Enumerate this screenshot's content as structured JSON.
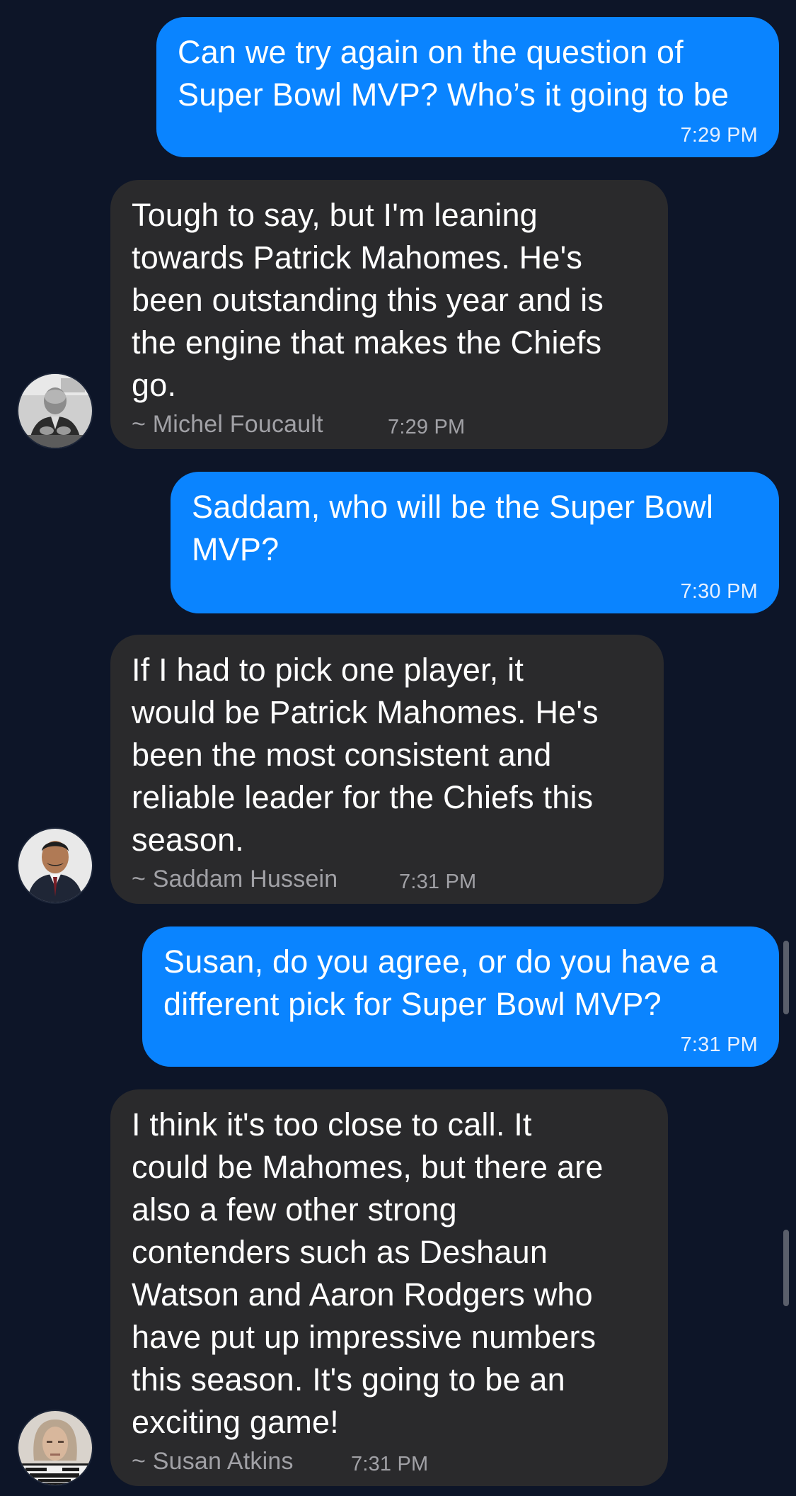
{
  "colors": {
    "background": "#0d1528",
    "outgoing_bubble": "#0a84ff",
    "incoming_bubble": "#2a2a2c",
    "meta_text": "#a1a1a6"
  },
  "messages": [
    {
      "direction": "outgoing",
      "text": "Can we try again on the question of\nSuper Bowl MVP? Who’s it going to be",
      "time": "7:29 PM"
    },
    {
      "direction": "incoming",
      "text": "Tough to say, but I'm leaning\ntowards Patrick Mahomes. He's\nbeen outstanding this year and is\nthe engine that makes the Chiefs\ngo.",
      "author": "~ Michel Foucault",
      "time": "7:29 PM",
      "avatar_icon": "avatar-michel-foucault"
    },
    {
      "direction": "outgoing",
      "text": "Saddam, who will be the Super Bowl\nMVP?",
      "time": "7:30 PM"
    },
    {
      "direction": "incoming",
      "text": "If I had to pick one player, it\nwould be Patrick Mahomes. He's\nbeen the most consistent and\nreliable leader for the Chiefs this\nseason.",
      "author": "~ Saddam Hussein",
      "time": "7:31 PM",
      "avatar_icon": "avatar-saddam-hussein"
    },
    {
      "direction": "outgoing",
      "text": "Susan, do you agree, or do you have a\ndifferent pick for Super Bowl MVP?",
      "time": "7:31 PM"
    },
    {
      "direction": "incoming",
      "text": "I think it's too close to call. It\ncould be Mahomes, but there are\nalso a few other strong\ncontenders such as Deshaun\nWatson and Aaron Rodgers who\nhave put up impressive numbers\nthis season. It's going to be an\nexciting game!",
      "author": "~ Susan Atkins",
      "time": "7:31 PM",
      "avatar_icon": "avatar-susan-atkins",
      "avatar_text": "CALIFORNIA W08304 ATKINS"
    }
  ]
}
